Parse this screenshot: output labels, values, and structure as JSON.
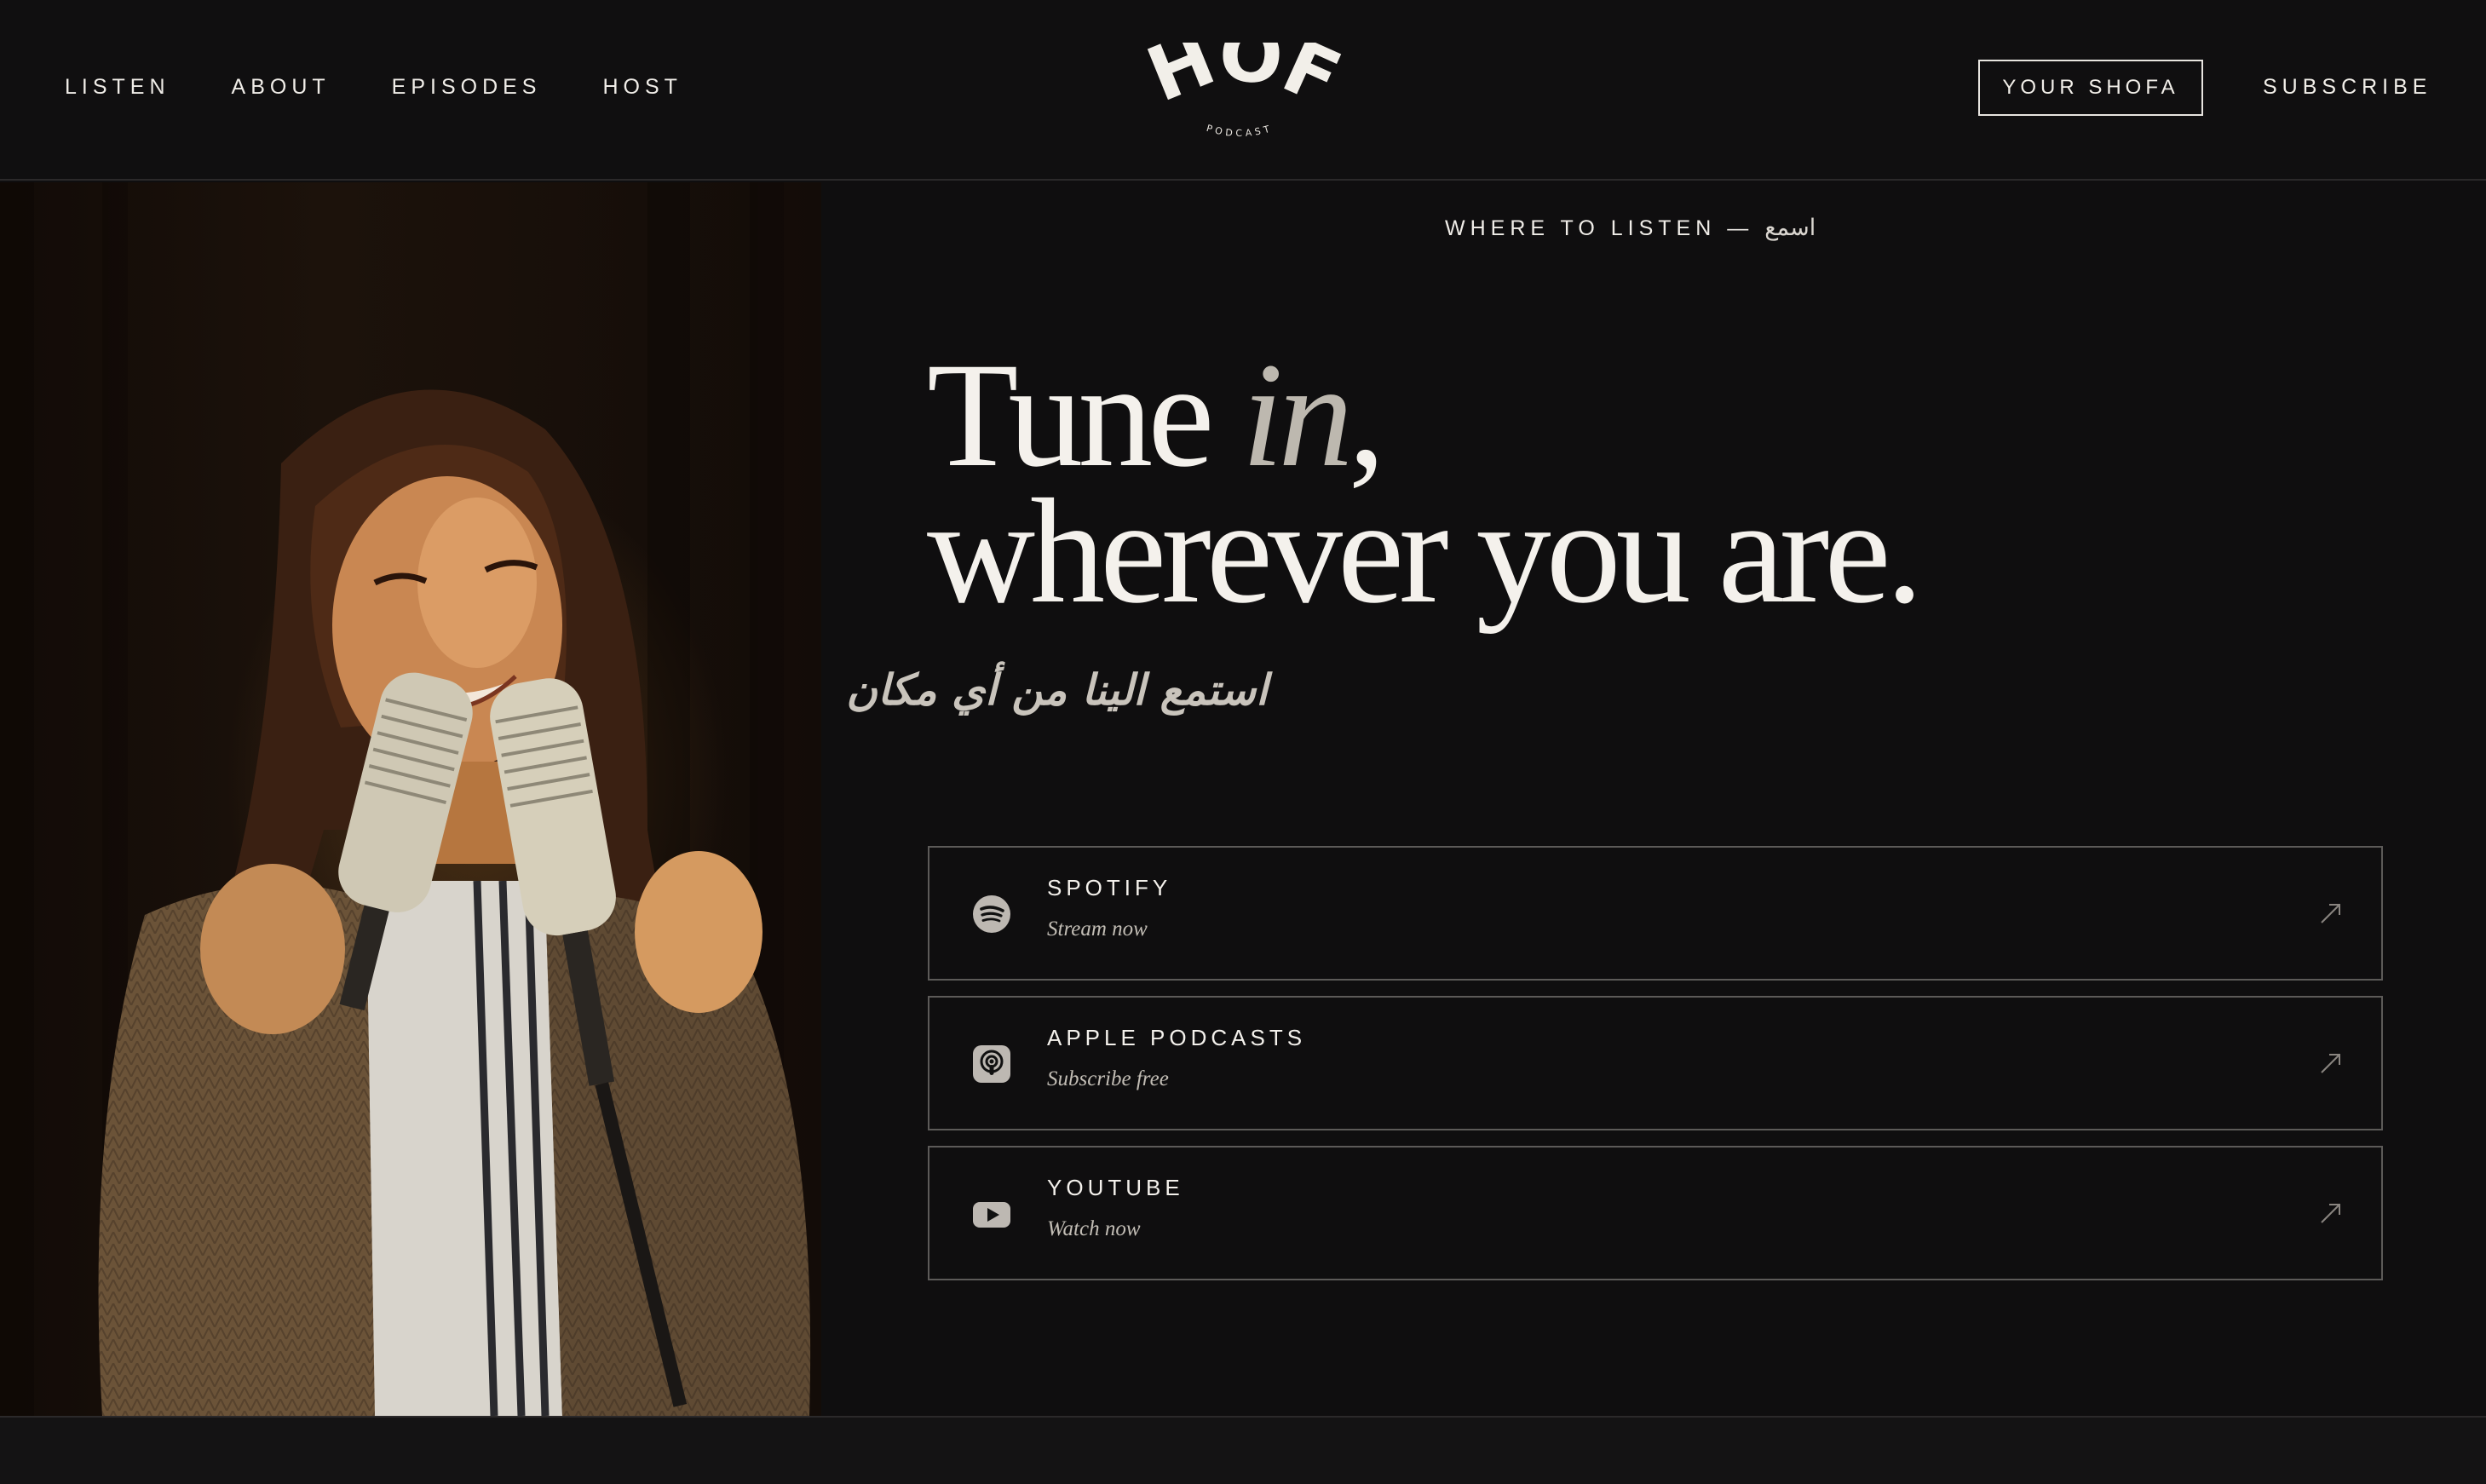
{
  "nav": {
    "links": [
      "LISTEN",
      "ABOUT",
      "EPISODES",
      "HOST"
    ],
    "your_shofa": "YOUR SHOFA",
    "subscribe": "SUBSCRIBE"
  },
  "logo": {
    "wordmark": "SHOFA",
    "sub": "PODCAST"
  },
  "hero": {
    "eyebrow": "WHERE TO LISTEN — ",
    "eyebrow_ar": "اسمع",
    "headline_1a": "Tune ",
    "headline_1b": "in",
    "headline_1c": ",",
    "headline_2": "wherever you are.",
    "arabic_tagline": "استمع الينا من أي مكان"
  },
  "platforms": [
    {
      "name": "SPOTIFY",
      "sub": "Stream now",
      "icon": "spotify-icon"
    },
    {
      "name": "APPLE PODCASTS",
      "sub": "Subscribe free",
      "icon": "apple-podcasts-icon"
    },
    {
      "name": "YOUTUBE",
      "sub": "Watch now",
      "icon": "youtube-icon"
    }
  ],
  "colors": {
    "background": "#0f0e0f",
    "text": "#f2efe9",
    "muted": "#bdb8af",
    "border": "#5c5a58"
  }
}
